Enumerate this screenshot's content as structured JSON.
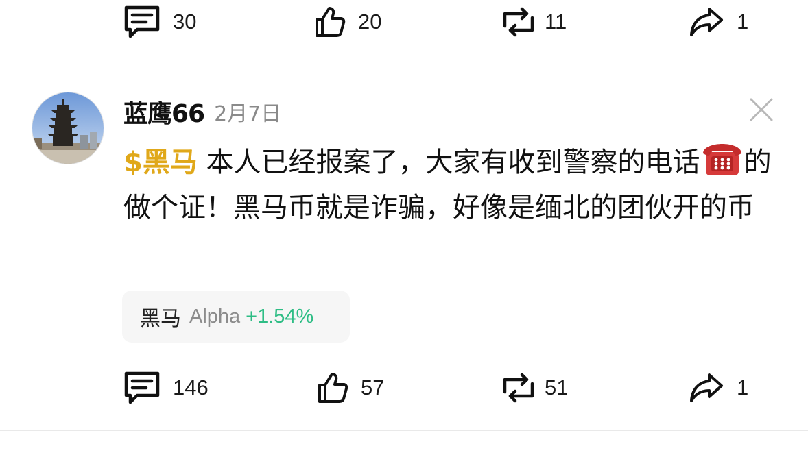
{
  "prev_post": {
    "actions": {
      "comments": "30",
      "likes": "20",
      "reposts": "11",
      "shares": "1"
    }
  },
  "post": {
    "username": "蓝鹰66",
    "date": "2月7日",
    "ticker": "$黑马",
    "text_part1": " 本人已经报案了，大家有收到警察的电话",
    "phone_emoji": "☎",
    "text_part2": "的做个证！黑马币就是诈骗，好像是缅北的团伙开的币",
    "ticker_card": {
      "name": "黑马",
      "tag": "Alpha",
      "change": "+1.54%"
    },
    "actions": {
      "comments": "146",
      "likes": "57",
      "reposts": "51",
      "shares": "1"
    }
  },
  "icons": [
    "comment-icon",
    "like-icon",
    "repost-icon",
    "share-icon",
    "close-icon",
    "telephone-emoji"
  ],
  "colors": {
    "ticker_gold": "#e0a81a",
    "positive_green": "#2ebd85",
    "muted_gray": "#8a8a8a",
    "card_bg": "#f6f6f6"
  }
}
